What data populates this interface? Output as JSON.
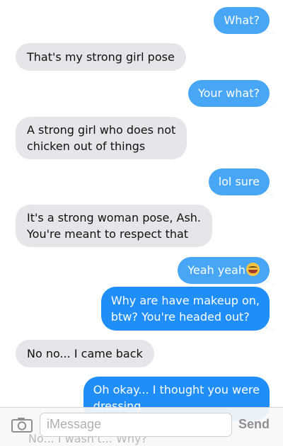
{
  "messages": [
    {
      "from": "me",
      "text": "What?"
    },
    {
      "from": "them",
      "text": "That's my strong girl pose"
    },
    {
      "from": "me",
      "text": "Your what?"
    },
    {
      "from": "them",
      "lines": [
        "A strong girl who does not",
        "chicken out of things"
      ]
    },
    {
      "from": "me",
      "text": "lol sure"
    },
    {
      "from": "them",
      "lines": [
        "It's a strong woman pose, Ash.",
        "You're meant to respect that"
      ]
    },
    {
      "from": "me",
      "text": "Yeah yeah",
      "emoji": "laughing-emoji"
    },
    {
      "from": "me",
      "lines": [
        "Why are have makeup on,",
        "btw? You're headed out?"
      ]
    },
    {
      "from": "them",
      "text": "No no... I came back"
    },
    {
      "from": "me",
      "lines": [
        "Oh okay... I thought you were",
        "dressing"
      ]
    },
    {
      "from": "them",
      "text": "No... I wasn't... Why?"
    }
  ],
  "composer": {
    "placeholder": "iMessage",
    "send_label": "Send",
    "camera_icon": "camera-icon"
  },
  "colors": {
    "incoming_bubble": "#e5e5ea",
    "outgoing_bubble": "#1f8ef8",
    "outgoing_bubble_light": "#47a6f6"
  }
}
